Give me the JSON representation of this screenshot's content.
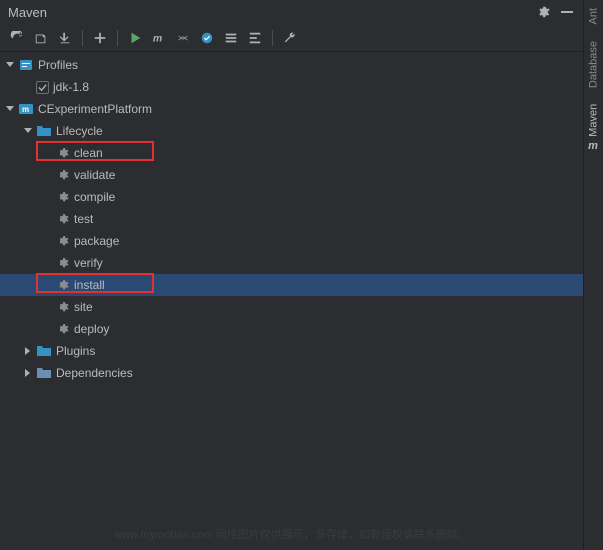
{
  "header": {
    "title": "Maven"
  },
  "side_tabs": [
    {
      "name": "ant",
      "label": "Ant"
    },
    {
      "name": "database",
      "label": "Database"
    },
    {
      "name": "maven",
      "label": "Maven",
      "icon": "m",
      "active": true
    }
  ],
  "tree": {
    "profiles": {
      "label": "Profiles",
      "expanded": true,
      "items": [
        {
          "label": "jdk-1.8",
          "checked": true
        }
      ]
    },
    "project": {
      "label": "CExperimentPlatform",
      "expanded": true,
      "lifecycle": {
        "label": "Lifecycle",
        "expanded": true,
        "goals": [
          {
            "label": "clean",
            "highlight": true
          },
          {
            "label": "validate"
          },
          {
            "label": "compile"
          },
          {
            "label": "test"
          },
          {
            "label": "package"
          },
          {
            "label": "verify"
          },
          {
            "label": "install",
            "selected": true,
            "highlight": true
          },
          {
            "label": "site"
          },
          {
            "label": "deploy"
          }
        ]
      },
      "plugins": {
        "label": "Plugins",
        "expanded": false
      },
      "dependencies": {
        "label": "Dependencies",
        "expanded": false
      }
    }
  },
  "watermark": "www.toymoban.com 网络图片仅供展示，非存储，如有侵权请联系删除。"
}
